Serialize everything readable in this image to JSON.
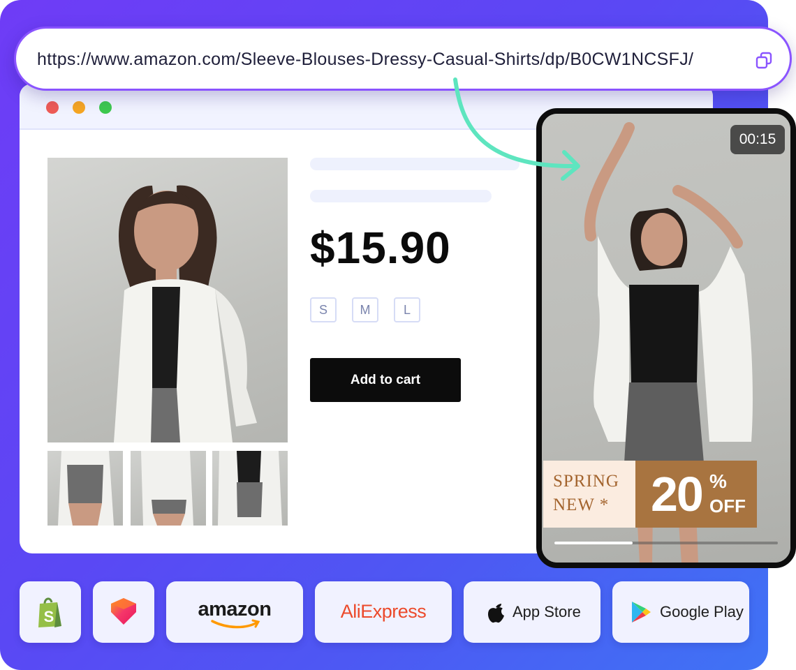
{
  "url_bar": {
    "url": "https://www.amazon.com/Sleeve-Blouses-Dressy-Casual-Shirts/dp/B0CW1NCSFJ/",
    "copy_icon": "copy-icon"
  },
  "product": {
    "price": "$15.90",
    "sizes": [
      "S",
      "M",
      "L"
    ],
    "add_to_cart_label": "Add to cart"
  },
  "video": {
    "timer": "00:15",
    "promo_line1": "SPRING",
    "promo_line2": "NEW *",
    "promo_discount": "20",
    "promo_percent": "%",
    "promo_off": "OFF",
    "progress": 0.35
  },
  "stores": [
    {
      "name": "Shopify",
      "icon": "shopify-bag-icon",
      "color": "#95bf47"
    },
    {
      "name": "Lazada",
      "icon": "lazada-heart-icon",
      "color": "#f5366a"
    },
    {
      "label": "amazon",
      "icon": "amazon-smile-icon",
      "color": "#ff9900"
    },
    {
      "label": "AliExpress",
      "color": "#ec4a2b"
    },
    {
      "label": "App Store",
      "icon": "apple-icon"
    },
    {
      "label": "Google Play",
      "icon": "google-play-icon"
    }
  ],
  "colors": {
    "panel_gradient_start": "#6f3cf6",
    "panel_gradient_end": "#3f73f5",
    "url_border": "#8a54ff",
    "arrow": "#5ee5bf",
    "cart_button": "#0c0c0c",
    "promo_cream": "#fbece0",
    "promo_brown": "#a87440"
  }
}
